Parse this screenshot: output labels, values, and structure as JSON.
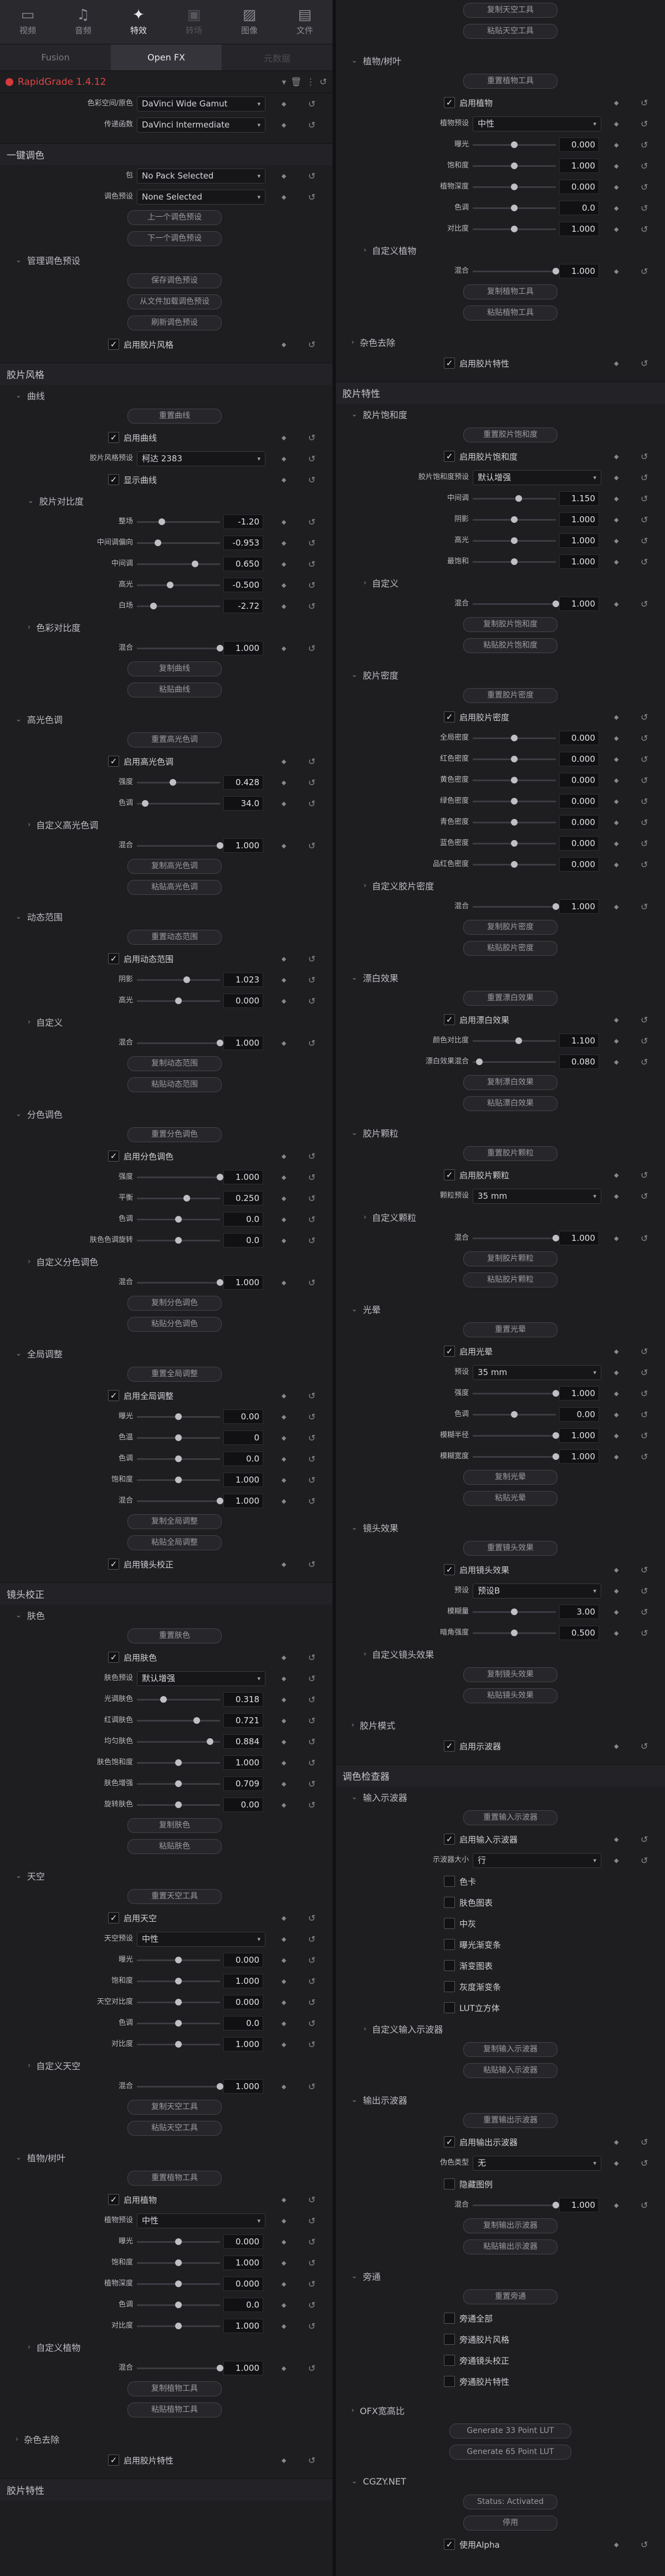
{
  "topbar": {
    "tabs": [
      {
        "icon": "▭",
        "label": "视频"
      },
      {
        "icon": "♫",
        "label": "音频"
      },
      {
        "icon": "✦",
        "label": "特效"
      },
      {
        "icon": "▣",
        "label": "转场"
      },
      {
        "icon": "▨",
        "label": "图像"
      },
      {
        "icon": "▤",
        "label": "文件"
      }
    ]
  },
  "subtabs": [
    "Fusion",
    "Open FX",
    "元数据"
  ],
  "plugin": {
    "name": "RapidGrade 1.4.12"
  },
  "left": [
    {
      "t": "dd",
      "l": "色彩空间/原色",
      "v": "DaVinci Wide Gamut"
    },
    {
      "t": "dd",
      "l": "传递函数",
      "v": "DaVinci Intermediate"
    },
    {
      "t": "gap"
    },
    {
      "t": "sec",
      "v": "一键调色"
    },
    {
      "t": "dd",
      "l": "包",
      "v": "No Pack Selected"
    },
    {
      "t": "dd",
      "l": "调色预设",
      "v": "None Selected"
    },
    {
      "t": "btn",
      "v": "上一个调色预设"
    },
    {
      "t": "btn",
      "v": "下一个调色预设"
    },
    {
      "t": "sub",
      "v": "管理调色预设",
      "i": 1
    },
    {
      "t": "btn",
      "v": "保存调色预设"
    },
    {
      "t": "btn",
      "v": "从文件加载调色预设"
    },
    {
      "t": "btn",
      "v": "刷新调色预设"
    },
    {
      "t": "cb",
      "v": "启用胶片风格"
    },
    {
      "t": "gap"
    },
    {
      "t": "sec",
      "v": "胶片风格"
    },
    {
      "t": "sub",
      "v": "曲线",
      "i": 1
    },
    {
      "t": "btn",
      "v": "重置曲线"
    },
    {
      "t": "cb",
      "v": "启用曲线"
    },
    {
      "t": "dd",
      "l": "胶片风格预设",
      "v": "柯达 2383"
    },
    {
      "t": "cb",
      "v": "显示曲线"
    },
    {
      "t": "sub",
      "v": "胶片对比度",
      "i": 2
    },
    {
      "t": "sl",
      "l": "整场",
      "v": "-1.20",
      "p": 0.3
    },
    {
      "t": "sl",
      "l": "中间调偏向",
      "v": "-0.953",
      "p": 0.25
    },
    {
      "t": "sl",
      "l": "中间调",
      "v": "0.650",
      "p": 0.7
    },
    {
      "t": "sl",
      "l": "高光",
      "v": "-0.500",
      "p": 0.4
    },
    {
      "t": "sl",
      "l": "白场",
      "v": "-2.72",
      "p": 0.2
    },
    {
      "t": "sub",
      "v": "色彩对比度",
      "i": 2,
      "c": 1
    },
    {
      "t": "sl",
      "l": "混合",
      "v": "1.000",
      "p": 1
    },
    {
      "t": "btn",
      "v": "复制曲线"
    },
    {
      "t": "btn",
      "v": "粘贴曲线"
    },
    {
      "t": "gap"
    },
    {
      "t": "sub",
      "v": "高光色调",
      "i": 1
    },
    {
      "t": "btn",
      "v": "重置高光色调"
    },
    {
      "t": "cb",
      "v": "启用高光色调"
    },
    {
      "t": "sl",
      "l": "强度",
      "v": "0.428",
      "p": 0.43
    },
    {
      "t": "sl",
      "l": "色调",
      "v": "34.0",
      "p": 0.1
    },
    {
      "t": "sub",
      "v": "自定义高光色调",
      "i": 2,
      "c": 1
    },
    {
      "t": "sl",
      "l": "混合",
      "v": "1.000",
      "p": 1
    },
    {
      "t": "btn",
      "v": "复制高光色调"
    },
    {
      "t": "btn",
      "v": "粘贴高光色调"
    },
    {
      "t": "gap"
    },
    {
      "t": "sub",
      "v": "动态范围",
      "i": 1
    },
    {
      "t": "btn",
      "v": "重置动态范围"
    },
    {
      "t": "cb",
      "v": "启用动态范围"
    },
    {
      "t": "sl",
      "l": "阴影",
      "v": "1.023",
      "p": 0.6
    },
    {
      "t": "sl",
      "l": "高光",
      "v": "0.000",
      "p": 0.5
    },
    {
      "t": "sub",
      "v": "自定义",
      "i": 2,
      "c": 1
    },
    {
      "t": "sl",
      "l": "混合",
      "v": "1.000",
      "p": 1
    },
    {
      "t": "btn",
      "v": "复制动态范围"
    },
    {
      "t": "btn",
      "v": "粘贴动态范围"
    },
    {
      "t": "gap"
    },
    {
      "t": "sub",
      "v": "分色调色",
      "i": 1
    },
    {
      "t": "btn",
      "v": "重置分色调色"
    },
    {
      "t": "cb",
      "v": "启用分色调色"
    },
    {
      "t": "sl",
      "l": "强度",
      "v": "1.000",
      "p": 1
    },
    {
      "t": "sl",
      "l": "平衡",
      "v": "0.250",
      "p": 0.6
    },
    {
      "t": "sl",
      "l": "色调",
      "v": "0.0",
      "p": 0.5
    },
    {
      "t": "sl",
      "l": "肤色色调旋转",
      "v": "0.0",
      "p": 0.5
    },
    {
      "t": "sub",
      "v": "自定义分色调色",
      "i": 2,
      "c": 1
    },
    {
      "t": "sl",
      "l": "混合",
      "v": "1.000",
      "p": 1
    },
    {
      "t": "btn",
      "v": "复制分色调色"
    },
    {
      "t": "btn",
      "v": "粘贴分色调色"
    },
    {
      "t": "gap"
    },
    {
      "t": "sub",
      "v": "全局调整",
      "i": 1
    },
    {
      "t": "btn",
      "v": "重置全局调整"
    },
    {
      "t": "cb",
      "v": "启用全局调整"
    },
    {
      "t": "sl",
      "l": "曝光",
      "v": "0.00",
      "p": 0.5
    },
    {
      "t": "sl",
      "l": "色温",
      "v": "0",
      "p": 0.5
    },
    {
      "t": "sl",
      "l": "色调",
      "v": "0.0",
      "p": 0.5
    },
    {
      "t": "sl",
      "l": "饱和度",
      "v": "1.000",
      "p": 0.5
    },
    {
      "t": "sl",
      "l": "混合",
      "v": "1.000",
      "p": 1
    },
    {
      "t": "btn",
      "v": "复制全局调整"
    },
    {
      "t": "btn",
      "v": "粘贴全局调整"
    },
    {
      "t": "cb",
      "v": "启用镜头校正"
    },
    {
      "t": "gap"
    },
    {
      "t": "sec",
      "v": "镜头校正"
    },
    {
      "t": "sub",
      "v": "肤色",
      "i": 1
    },
    {
      "t": "btn",
      "v": "重置肤色"
    },
    {
      "t": "cb",
      "v": "启用肤色"
    },
    {
      "t": "dd",
      "l": "肤色预设",
      "v": "默认增强"
    },
    {
      "t": "sl",
      "l": "光调肤色",
      "v": "0.318",
      "p": 0.32
    },
    {
      "t": "sl",
      "l": "红调肤色",
      "v": "0.721",
      "p": 0.72
    },
    {
      "t": "sl",
      "l": "均匀肤色",
      "v": "0.884",
      "p": 0.88
    },
    {
      "t": "sl",
      "l": "肤色饱和度",
      "v": "1.000",
      "p": 0.5
    },
    {
      "t": "sl",
      "l": "肤色增强",
      "v": "0.709",
      "p": 0.5
    },
    {
      "t": "sl",
      "l": "旋转肤色",
      "v": "0.00",
      "p": 0.5
    },
    {
      "t": "btn",
      "v": "复制肤色"
    },
    {
      "t": "btn",
      "v": "粘贴肤色"
    },
    {
      "t": "gap"
    },
    {
      "t": "sub",
      "v": "天空",
      "i": 1
    },
    {
      "t": "btn",
      "v": "重置天空工具"
    },
    {
      "t": "cb",
      "v": "启用天空"
    },
    {
      "t": "dd",
      "l": "天空预设",
      "v": "中性"
    },
    {
      "t": "sl",
      "l": "曝光",
      "v": "0.000",
      "p": 0.5
    },
    {
      "t": "sl",
      "l": "饱和度",
      "v": "1.000",
      "p": 0.5
    },
    {
      "t": "sl",
      "l": "天空对比度",
      "v": "0.000",
      "p": 0.5
    },
    {
      "t": "sl",
      "l": "色调",
      "v": "0.0",
      "p": 0.5
    },
    {
      "t": "sl",
      "l": "对比度",
      "v": "1.000",
      "p": 0.5
    },
    {
      "t": "sub",
      "v": "自定义天空",
      "i": 2,
      "c": 1
    },
    {
      "t": "sl",
      "l": "混合",
      "v": "1.000",
      "p": 1
    },
    {
      "t": "btn",
      "v": "复制天空工具"
    },
    {
      "t": "btn",
      "v": "粘贴天空工具"
    },
    {
      "t": "gap"
    },
    {
      "t": "sub",
      "v": "植物/树叶",
      "i": 1
    },
    {
      "t": "btn",
      "v": "重置植物工具"
    },
    {
      "t": "cb",
      "v": "启用植物"
    },
    {
      "t": "dd",
      "l": "植物预设",
      "v": "中性"
    },
    {
      "t": "sl",
      "l": "曝光",
      "v": "0.000",
      "p": 0.5
    },
    {
      "t": "sl",
      "l": "饱和度",
      "v": "1.000",
      "p": 0.5
    },
    {
      "t": "sl",
      "l": "植物深度",
      "v": "0.000",
      "p": 0.5
    },
    {
      "t": "sl",
      "l": "色调",
      "v": "0.0",
      "p": 0.5
    },
    {
      "t": "sl",
      "l": "对比度",
      "v": "1.000",
      "p": 0.5
    },
    {
      "t": "sub",
      "v": "自定义植物",
      "i": 2,
      "c": 1
    },
    {
      "t": "sl",
      "l": "混合",
      "v": "1.000",
      "p": 1
    },
    {
      "t": "btn",
      "v": "复制植物工具"
    },
    {
      "t": "btn",
      "v": "粘贴植物工具"
    },
    {
      "t": "gap"
    },
    {
      "t": "sub",
      "v": "杂色去除",
      "i": 1,
      "c": 1
    },
    {
      "t": "cb",
      "v": "启用胶片特性"
    },
    {
      "t": "gap"
    },
    {
      "t": "sec",
      "v": "胶片特性"
    }
  ],
  "right": [
    {
      "t": "btn",
      "v": "复制天空工具"
    },
    {
      "t": "btn",
      "v": "粘贴天空工具"
    },
    {
      "t": "gap"
    },
    {
      "t": "sub",
      "v": "植物/树叶",
      "i": 1
    },
    {
      "t": "btn",
      "v": "重置植物工具"
    },
    {
      "t": "cb",
      "v": "启用植物"
    },
    {
      "t": "dd",
      "l": "植物预设",
      "v": "中性"
    },
    {
      "t": "sl",
      "l": "曝光",
      "v": "0.000",
      "p": 0.5
    },
    {
      "t": "sl",
      "l": "饱和度",
      "v": "1.000",
      "p": 0.5
    },
    {
      "t": "sl",
      "l": "植物深度",
      "v": "0.000",
      "p": 0.5
    },
    {
      "t": "sl",
      "l": "色调",
      "v": "0.0",
      "p": 0.5
    },
    {
      "t": "sl",
      "l": "对比度",
      "v": "1.000",
      "p": 0.5
    },
    {
      "t": "sub",
      "v": "自定义植物",
      "i": 2,
      "c": 1
    },
    {
      "t": "sl",
      "l": "混合",
      "v": "1.000",
      "p": 1
    },
    {
      "t": "btn",
      "v": "复制植物工具"
    },
    {
      "t": "btn",
      "v": "粘贴植物工具"
    },
    {
      "t": "gap"
    },
    {
      "t": "sub",
      "v": "杂色去除",
      "i": 1,
      "c": 1
    },
    {
      "t": "cb",
      "v": "启用胶片特性"
    },
    {
      "t": "gap"
    },
    {
      "t": "sec",
      "v": "胶片特性"
    },
    {
      "t": "sub",
      "v": "胶片饱和度",
      "i": 1
    },
    {
      "t": "btn",
      "v": "重置胶片饱和度"
    },
    {
      "t": "cb",
      "v": "启用胶片饱和度"
    },
    {
      "t": "dd",
      "l": "胶片饱和度预设",
      "v": "默认增强"
    },
    {
      "t": "sl",
      "l": "中间调",
      "v": "1.150",
      "p": 0.55
    },
    {
      "t": "sl",
      "l": "阴影",
      "v": "1.000",
      "p": 0.5
    },
    {
      "t": "sl",
      "l": "高光",
      "v": "1.000",
      "p": 0.5
    },
    {
      "t": "sl",
      "l": "最饱和",
      "v": "1.000",
      "p": 0.5
    },
    {
      "t": "sub",
      "v": "自定义",
      "i": 2,
      "c": 1
    },
    {
      "t": "sl",
      "l": "混合",
      "v": "1.000",
      "p": 1
    },
    {
      "t": "btn",
      "v": "复制胶片饱和度"
    },
    {
      "t": "btn",
      "v": "粘贴胶片饱和度"
    },
    {
      "t": "gap"
    },
    {
      "t": "sub",
      "v": "胶片密度",
      "i": 1
    },
    {
      "t": "btn",
      "v": "重置胶片密度"
    },
    {
      "t": "cb",
      "v": "启用胶片密度"
    },
    {
      "t": "sl",
      "l": "全局密度",
      "v": "0.000",
      "p": 0.5
    },
    {
      "t": "sl",
      "l": "红色密度",
      "v": "0.000",
      "p": 0.5
    },
    {
      "t": "sl",
      "l": "黄色密度",
      "v": "0.000",
      "p": 0.5
    },
    {
      "t": "sl",
      "l": "绿色密度",
      "v": "0.000",
      "p": 0.5
    },
    {
      "t": "sl",
      "l": "青色密度",
      "v": "0.000",
      "p": 0.5
    },
    {
      "t": "sl",
      "l": "蓝色密度",
      "v": "0.000",
      "p": 0.5
    },
    {
      "t": "sl",
      "l": "品红色密度",
      "v": "0.000",
      "p": 0.5
    },
    {
      "t": "sub",
      "v": "自定义胶片密度",
      "i": 2,
      "c": 1
    },
    {
      "t": "sl",
      "l": "混合",
      "v": "1.000",
      "p": 1
    },
    {
      "t": "btn",
      "v": "复制胶片密度"
    },
    {
      "t": "btn",
      "v": "粘贴胶片密度"
    },
    {
      "t": "gap"
    },
    {
      "t": "sub",
      "v": "漂白效果",
      "i": 1
    },
    {
      "t": "btn",
      "v": "重置漂白效果"
    },
    {
      "t": "cb",
      "v": "启用漂白效果"
    },
    {
      "t": "sl",
      "l": "颜色对比度",
      "v": "1.100",
      "p": 0.55
    },
    {
      "t": "sl",
      "l": "漂白效果混合",
      "v": "0.080",
      "p": 0.08
    },
    {
      "t": "btn",
      "v": "复制漂白效果"
    },
    {
      "t": "btn",
      "v": "粘贴漂白效果"
    },
    {
      "t": "gap"
    },
    {
      "t": "sub",
      "v": "胶片颗粒",
      "i": 1
    },
    {
      "t": "btn",
      "v": "重置胶片颗粒"
    },
    {
      "t": "cb",
      "v": "启用胶片颗粒"
    },
    {
      "t": "dd",
      "l": "颗粒预设",
      "v": "35 mm"
    },
    {
      "t": "sub",
      "v": "自定义颗粒",
      "i": 2,
      "c": 1
    },
    {
      "t": "sl",
      "l": "混合",
      "v": "1.000",
      "p": 1
    },
    {
      "t": "btn",
      "v": "复制胶片颗粒"
    },
    {
      "t": "btn",
      "v": "粘贴胶片颗粒"
    },
    {
      "t": "gap"
    },
    {
      "t": "sub",
      "v": "光晕",
      "i": 1
    },
    {
      "t": "btn",
      "v": "重置光晕"
    },
    {
      "t": "cb",
      "v": "启用光晕"
    },
    {
      "t": "dd",
      "l": "预设",
      "v": "35 mm"
    },
    {
      "t": "sl",
      "l": "强度",
      "v": "1.000",
      "p": 1
    },
    {
      "t": "sl",
      "l": "色调",
      "v": "0.00",
      "p": 0.5
    },
    {
      "t": "sl",
      "l": "模糊半径",
      "v": "1.000",
      "p": 1
    },
    {
      "t": "sl",
      "l": "模糊宽度",
      "v": "1.000",
      "p": 1
    },
    {
      "t": "btn",
      "v": "复制光晕"
    },
    {
      "t": "btn",
      "v": "粘贴光晕"
    },
    {
      "t": "gap"
    },
    {
      "t": "sub",
      "v": "镜头效果",
      "i": 1
    },
    {
      "t": "btn",
      "v": "重置镜头效果"
    },
    {
      "t": "cb",
      "v": "启用镜头效果"
    },
    {
      "t": "dd",
      "l": "预设",
      "v": "预设B"
    },
    {
      "t": "sl",
      "l": "模糊量",
      "v": "3.00",
      "p": 0.5
    },
    {
      "t": "sl",
      "l": "暗角强度",
      "v": "0.500",
      "p": 0.5
    },
    {
      "t": "sub",
      "v": "自定义镜头效果",
      "i": 2,
      "c": 1
    },
    {
      "t": "btn",
      "v": "复制镜头效果"
    },
    {
      "t": "btn",
      "v": "粘贴镜头效果"
    },
    {
      "t": "gap"
    },
    {
      "t": "sub",
      "v": "胶片模式",
      "i": 1,
      "c": 1
    },
    {
      "t": "cb",
      "v": "启用示波器"
    },
    {
      "t": "gap"
    },
    {
      "t": "sec",
      "v": "调色检查器"
    },
    {
      "t": "sub",
      "v": "输入示波器",
      "i": 1
    },
    {
      "t": "btn",
      "v": "重置输入示波器"
    },
    {
      "t": "cb",
      "v": "启用输入示波器"
    },
    {
      "t": "dd",
      "l": "示波器大小",
      "v": "行"
    },
    {
      "t": "cbu",
      "v": "色卡"
    },
    {
      "t": "cbu",
      "v": "肤色图表"
    },
    {
      "t": "cbu",
      "v": "中灰"
    },
    {
      "t": "cbu",
      "v": "曝光渐变条"
    },
    {
      "t": "cbu",
      "v": "渐变图表"
    },
    {
      "t": "cbu",
      "v": "灰度渐变条"
    },
    {
      "t": "cbu",
      "v": "LUT立方体"
    },
    {
      "t": "sub",
      "v": "自定义输入示波器",
      "i": 2,
      "c": 1
    },
    {
      "t": "btn",
      "v": "复制输入示波器"
    },
    {
      "t": "btn",
      "v": "粘贴输入示波器"
    },
    {
      "t": "gap"
    },
    {
      "t": "sub",
      "v": "输出示波器",
      "i": 1
    },
    {
      "t": "btn",
      "v": "重置输出示波器"
    },
    {
      "t": "cb",
      "v": "启用输出示波器"
    },
    {
      "t": "dd",
      "l": "伪色类型",
      "v": "无"
    },
    {
      "t": "cbu",
      "v": "隐藏图例"
    },
    {
      "t": "sl",
      "l": "混合",
      "v": "1.000",
      "p": 1
    },
    {
      "t": "btn",
      "v": "复制输出示波器"
    },
    {
      "t": "btn",
      "v": "粘贴输出示波器"
    },
    {
      "t": "gap"
    },
    {
      "t": "sub",
      "v": "旁通",
      "i": 1
    },
    {
      "t": "btn",
      "v": "重置旁通"
    },
    {
      "t": "cbu",
      "v": "旁通全部"
    },
    {
      "t": "cbu",
      "v": "旁通胶片风格"
    },
    {
      "t": "cbu",
      "v": "旁通镜头校正"
    },
    {
      "t": "cbu",
      "v": "旁通胶片特性"
    },
    {
      "t": "gap"
    },
    {
      "t": "sub",
      "v": "OFX宽高比",
      "i": 1,
      "c": 1
    },
    {
      "t": "btnw",
      "v": "Generate 33 Point LUT"
    },
    {
      "t": "btnw",
      "v": "Generate 65 Point LUT"
    },
    {
      "t": "gap"
    },
    {
      "t": "sub",
      "v": "CGZY.NET",
      "i": 1
    },
    {
      "t": "btn",
      "v": "Status: Activated"
    },
    {
      "t": "btn",
      "v": "停用"
    },
    {
      "t": "cb",
      "v": "使用Alpha"
    }
  ]
}
